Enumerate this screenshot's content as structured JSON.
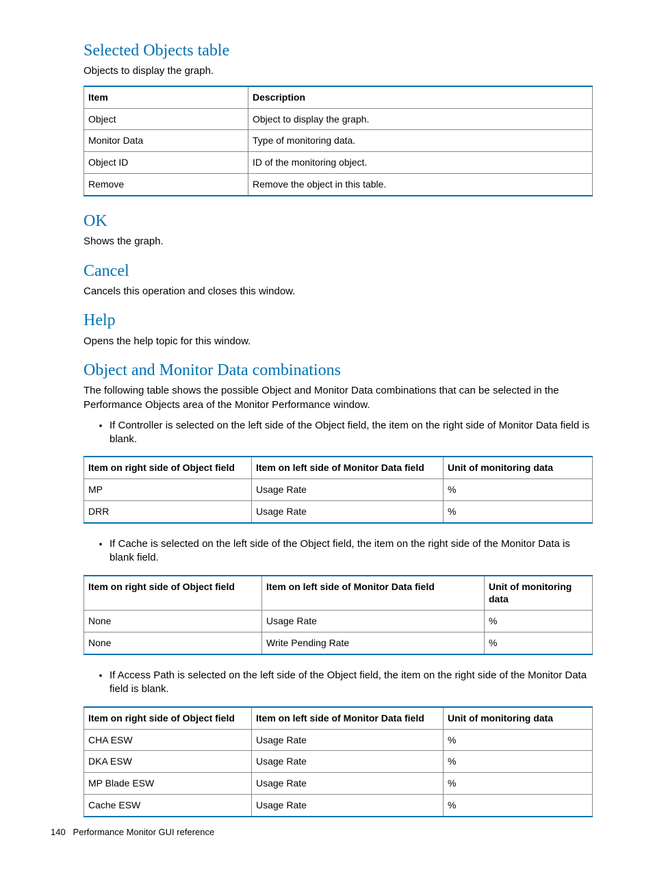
{
  "sections": {
    "selected_objects": {
      "heading": "Selected Objects table",
      "intro": "Objects to display the graph.",
      "table": {
        "headers": [
          "Item",
          "Description"
        ],
        "rows": [
          [
            "Object",
            "Object to display the graph."
          ],
          [
            "Monitor Data",
            "Type of monitoring data."
          ],
          [
            "Object ID",
            "ID of the monitoring object."
          ],
          [
            "Remove",
            "Remove the object in this table."
          ]
        ]
      }
    },
    "ok": {
      "heading": "OK",
      "text": "Shows the graph."
    },
    "cancel": {
      "heading": "Cancel",
      "text": "Cancels this operation and closes this window."
    },
    "help": {
      "heading": "Help",
      "text": "Opens the help topic for this window."
    },
    "combos": {
      "heading": "Object and Monitor Data combinations",
      "intro": "The following table shows the possible Object and Monitor Data combinations that can be selected in the Performance Objects area of the Monitor Performance window.",
      "bullet1": "If Controller is selected on the left side of the Object field, the item on the right side of Monitor Data field is blank.",
      "table1": {
        "headers": [
          "Item on right side of Object field",
          "Item on left side of Monitor Data field",
          "Unit of monitoring data"
        ],
        "rows": [
          [
            "MP",
            "Usage Rate",
            "%"
          ],
          [
            "DRR",
            "Usage Rate",
            "%"
          ]
        ]
      },
      "bullet2": "If Cache is selected on the left side of the Object field, the item on the right side of the Monitor Data is blank field.",
      "table2": {
        "headers": [
          "Item on right side of Object field",
          "Item on left side of Monitor Data field",
          "Unit of monitoring data"
        ],
        "rows": [
          [
            "None",
            "Usage Rate",
            "%"
          ],
          [
            "None",
            "Write Pending Rate",
            "%"
          ]
        ]
      },
      "bullet3": "If Access Path is selected on the left side of the Object field, the item on the right side of the Monitor Data field is blank.",
      "table3": {
        "headers": [
          "Item on right side of Object field",
          "Item on left side of Monitor Data field",
          "Unit of monitoring data"
        ],
        "rows": [
          [
            "CHA ESW",
            "Usage Rate",
            "%"
          ],
          [
            "DKA ESW",
            "Usage Rate",
            "%"
          ],
          [
            "MP Blade ESW",
            "Usage Rate",
            "%"
          ],
          [
            "Cache ESW",
            "Usage Rate",
            "%"
          ]
        ]
      }
    }
  },
  "footer": {
    "page": "140",
    "title": "Performance Monitor GUI reference"
  }
}
